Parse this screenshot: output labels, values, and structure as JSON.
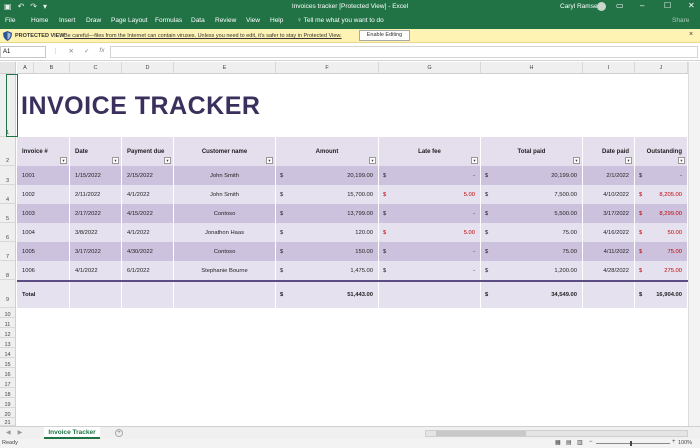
{
  "titlebar": {
    "doc_title": "Invoices tracker  [Protected View]  -  Excel",
    "user": "Caryl Ramsey",
    "share": "Share",
    "min": "–",
    "max": "☐",
    "close": "✕"
  },
  "ribbon_tabs": [
    "File",
    "Home",
    "Insert",
    "Draw",
    "Page Layout",
    "Formulas",
    "Data",
    "Review",
    "View",
    "Help"
  ],
  "tell_me": "Tell me what you want to do",
  "protected_view": {
    "title": "PROTECTED VIEW",
    "message": "Be careful—files from the Internet can contain viruses. Unless you need to edit, it's safer to stay in Protected View.",
    "button": "Enable Editing",
    "close": "×"
  },
  "formula_bar": {
    "name_box": "A1",
    "fx": "fx",
    "value": ""
  },
  "columns": [
    "A",
    "B",
    "C",
    "D",
    "E",
    "F",
    "G",
    "H",
    "I",
    "J"
  ],
  "rows": [
    "1",
    "2",
    "3",
    "4",
    "5",
    "6",
    "7",
    "8",
    "9",
    "10",
    "11",
    "12",
    "13",
    "14",
    "15",
    "16",
    "17",
    "18",
    "19",
    "20",
    "21"
  ],
  "sheet_title": "INVOICE TRACKER",
  "table": {
    "headers": [
      "Invoice #",
      "Date",
      "Payment due",
      "Customer name",
      "Amount",
      "Late fee",
      "Total paid",
      "Date paid",
      "Outstanding"
    ],
    "currency": "$",
    "rows": [
      {
        "invoice": "1001",
        "date": "1/15/2022",
        "due": "2/15/2022",
        "customer": "John Smith",
        "amount": "20,199.00",
        "late_fee": "-",
        "total_paid": "20,199.00",
        "date_paid": "2/1/2022",
        "outstanding": "-"
      },
      {
        "invoice": "1002",
        "date": "2/11/2022",
        "due": "4/1/2022",
        "customer": "John Smith",
        "amount": "15,700.00",
        "late_fee": "5.00",
        "total_paid": "7,500.00",
        "date_paid": "4/10/2022",
        "outstanding": "8,205.00"
      },
      {
        "invoice": "1003",
        "date": "2/17/2022",
        "due": "4/15/2022",
        "customer": "Contoso",
        "amount": "13,799.00",
        "late_fee": "-",
        "total_paid": "5,500.00",
        "date_paid": "3/17/2022",
        "outstanding": "8,299.00"
      },
      {
        "invoice": "1004",
        "date": "3/8/2022",
        "due": "4/1/2022",
        "customer": "Jonathon Haas",
        "amount": "120.00",
        "late_fee": "5.00",
        "total_paid": "75.00",
        "date_paid": "4/16/2022",
        "outstanding": "50.00"
      },
      {
        "invoice": "1005",
        "date": "3/17/2022",
        "due": "4/30/2022",
        "customer": "Contoso",
        "amount": "150.00",
        "late_fee": "-",
        "total_paid": "75.00",
        "date_paid": "4/11/2022",
        "outstanding": "75.00"
      },
      {
        "invoice": "1006",
        "date": "4/1/2022",
        "due": "6/1/2022",
        "customer": "Stephanie Bourne",
        "amount": "1,475.00",
        "late_fee": "-",
        "total_paid": "1,200.00",
        "date_paid": "4/28/2022",
        "outstanding": "275.00"
      }
    ],
    "total": {
      "label": "Total",
      "amount": "51,443.00",
      "total_paid": "34,549.00",
      "outstanding": "16,904.00"
    }
  },
  "sheet_tab": "Invoice Tracker",
  "status": {
    "ready": "Ready",
    "zoom": "100%"
  },
  "colors": {
    "excel_green": "#217346",
    "title": "#3b2f5c",
    "header_fill": "#e4deed",
    "dark_row": "#cdc2dd",
    "light_row": "#e6e1ef",
    "negative": "#c00000",
    "protected_bar": "#fff3b3"
  }
}
